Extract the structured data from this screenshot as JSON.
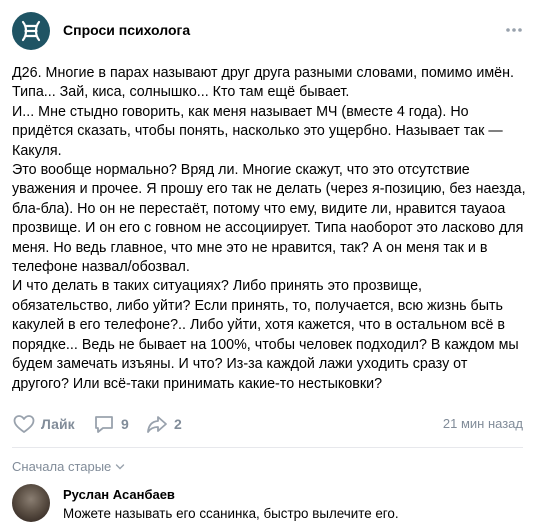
{
  "group": {
    "name": "Спроси психолога",
    "more_icon": "more-horizontal-icon"
  },
  "post": {
    "lines": [
      "Д26. Многие в парах называют друг друга разными словами, помимо имён.",
      "Типа... Зай, киса, солнышко... Кто там ещё бывает.",
      "И... Мне стыдно говорить, как меня называет МЧ (вместе 4 года). Но",
      "придётся сказать, чтобы понять, насколько это ущербно. Называет так —",
      "Какуля.",
      "Это вообще нормально? Вряд ли. Многие скажут, что это отсутствие",
      "уважения и прочее. Я прошу его так не делать (через я-позицию, без наезда,",
      "бла-бла). Но он не перестаёт, потому что ему, видите ли, нравится тауаоа",
      "прозвище. И он его с говном не ассоциирует. Типа наоборот это ласково для",
      "меня. Но ведь главное, что мне это не нравится, так? А он меня так и в",
      "телефоне назвал/обозвал.",
      "И что делать в таких ситуациях? Либо принять это прозвище,",
      "обязательство, либо уйти? Если принять, то, получается, всю жизнь быть",
      "какулей в его телефоне?.. Либо уйти, хотя кажется, что в остальном всё в",
      "порядке... Ведь не бывает на 100%, чтобы человек подходил? В каждом мы",
      "будем замечать изъяны. И что? Из-за каждой лажи уходить сразу от",
      "другого? Или всё-таки принимать какие-то нестыковки?"
    ]
  },
  "actions": {
    "like_label": "Лайк",
    "comments_count": "9",
    "shares_count": "2",
    "time": "21 мин назад"
  },
  "comments": {
    "sort_label": "Сначала старые",
    "items": [
      {
        "author": "Руслан Асанбаев",
        "text": "Можете называть его ссанинка, быстро вылечите его."
      }
    ]
  },
  "colors": {
    "muted": "#818c99",
    "logo": "#1f5464",
    "divider": "#e7e8ec"
  }
}
